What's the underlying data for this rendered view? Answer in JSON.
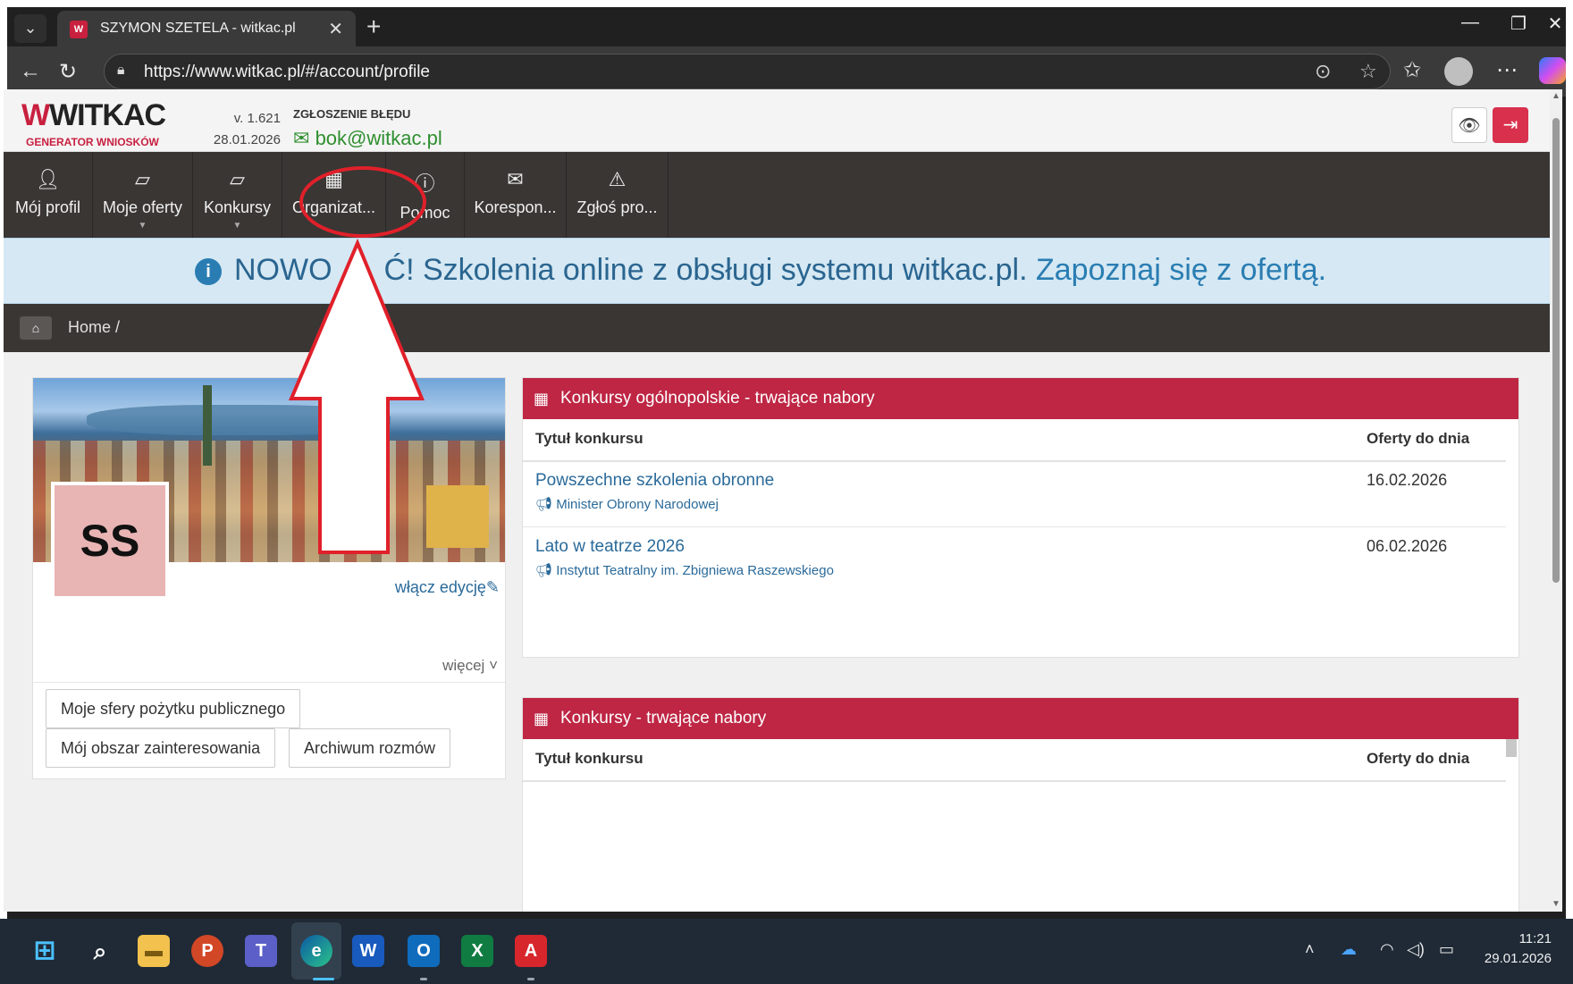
{
  "browser": {
    "tab_title": "SZYMON SZETELA - witkac.pl",
    "favicon_text": "W",
    "url": "https://www.witkac.pl/#/account/profile"
  },
  "header": {
    "logo": "WITKAC",
    "logo_sub": "GENERATOR WNIOSKÓW",
    "version": "v. 1.621",
    "date": "28.01.2026",
    "bug_label": "ZGŁOSZENIE BŁĘDU",
    "bug_email": "bok@witkac.pl"
  },
  "nav": {
    "items": [
      {
        "label": "Mój profil",
        "icon": "user-icon"
      },
      {
        "label": "Moje oferty",
        "icon": "book-icon"
      },
      {
        "label": "Konkursy",
        "icon": "book-icon"
      },
      {
        "label": "Organizat...",
        "icon": "building-icon"
      },
      {
        "label": "Pomoc",
        "icon": "info-icon"
      },
      {
        "label": "Korespon...",
        "icon": "envelope-icon"
      },
      {
        "label": "Zgłoś pro...",
        "icon": "warning-icon"
      }
    ]
  },
  "announcement": {
    "text": "NOWOŚĆ! Szkolenia online z obsługi systemu witkac.pl.",
    "text_visible_left": "NOWO",
    "text_visible_right": "Ć! Szkolenia online z obsługi systemu witkac.pl.",
    "link": "Zapoznaj się z ofertą."
  },
  "breadcrumb": {
    "home": "Home /"
  },
  "profile": {
    "initials": "SS",
    "edit_link": "włącz edycję",
    "more_link": "więcej",
    "buttons": [
      "Moje sfery pożytku publicznego",
      "Mój obszar zainteresowania",
      "Archiwum rozmów"
    ]
  },
  "panel_national": {
    "title": "Konkursy ogólnopolskie - trwające nabory",
    "col_title": "Tytuł konkursu",
    "col_date": "Oferty do dnia",
    "rows": [
      {
        "title": "Powszechne szkolenia obronne",
        "org": "Minister Obrony Narodowej",
        "date": "16.02.2026"
      },
      {
        "title": "Lato w teatrze 2026",
        "org": "Instytut Teatralny im. Zbigniewa Raszewskiego",
        "date": "06.02.2026"
      }
    ]
  },
  "panel_all": {
    "title": "Konkursy - trwające nabory",
    "col_title": "Tytuł konkursu",
    "col_date": "Oferty do dnia"
  },
  "taskbar": {
    "time": "11:21",
    "date": "29.01.2026"
  },
  "colors": {
    "brand_red": "#be2644",
    "navbar": "#393634",
    "link_blue": "#2a6a9a",
    "annotation_red": "#e0202a"
  }
}
